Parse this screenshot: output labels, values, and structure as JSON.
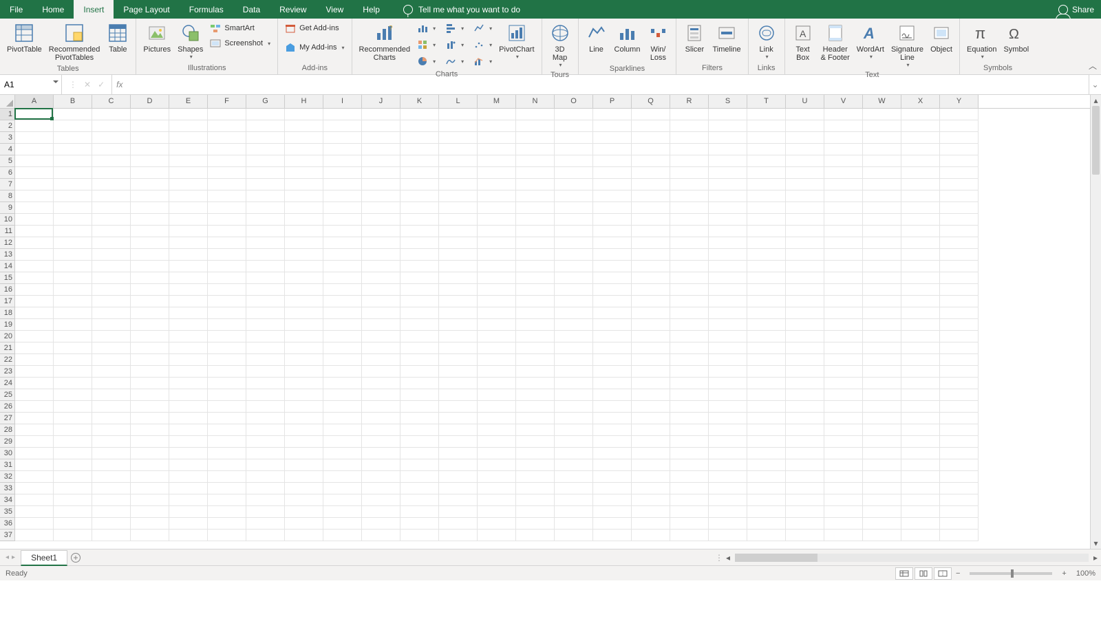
{
  "menu": {
    "tabs": [
      "File",
      "Home",
      "Insert",
      "Page Layout",
      "Formulas",
      "Data",
      "Review",
      "View",
      "Help"
    ],
    "active_index": 2,
    "tell_me": "Tell me what you want to do",
    "share": "Share"
  },
  "ribbon": {
    "groups": {
      "tables": {
        "label": "Tables",
        "items": {
          "pivot": "PivotTable",
          "rec": "Recommended\nPivotTables",
          "table": "Table"
        }
      },
      "illustrations": {
        "label": "Illustrations",
        "items": {
          "pictures": "Pictures",
          "shapes": "Shapes",
          "smartart": "SmartArt",
          "screenshot": "Screenshot"
        }
      },
      "addins": {
        "label": "Add-ins",
        "items": {
          "get": "Get Add-ins",
          "my": "My Add-ins"
        }
      },
      "charts": {
        "label": "Charts",
        "items": {
          "rec": "Recommended\nCharts",
          "pivotchart": "PivotChart"
        }
      },
      "tours": {
        "label": "Tours",
        "items": {
          "map": "3D\nMap"
        }
      },
      "sparklines": {
        "label": "Sparklines",
        "items": {
          "line": "Line",
          "column": "Column",
          "winloss": "Win/\nLoss"
        }
      },
      "filters": {
        "label": "Filters",
        "items": {
          "slicer": "Slicer",
          "timeline": "Timeline"
        }
      },
      "links": {
        "label": "Links",
        "items": {
          "link": "Link"
        }
      },
      "text": {
        "label": "Text",
        "items": {
          "textbox": "Text\nBox",
          "header": "Header\n& Footer",
          "wordart": "WordArt",
          "sig": "Signature\nLine",
          "object": "Object"
        }
      },
      "symbols": {
        "label": "Symbols",
        "items": {
          "eq": "Equation",
          "sym": "Symbol"
        }
      }
    }
  },
  "namebox": {
    "value": "A1"
  },
  "formula_bar": {
    "fx": "fx",
    "value": ""
  },
  "grid": {
    "columns": [
      "A",
      "B",
      "C",
      "D",
      "E",
      "F",
      "G",
      "H",
      "I",
      "J",
      "K",
      "L",
      "M",
      "N",
      "O",
      "P",
      "Q",
      "R",
      "S",
      "T",
      "U",
      "V",
      "W",
      "X",
      "Y"
    ],
    "rows": 37,
    "selected_cell": "A1",
    "selected_col_index": 0,
    "selected_row_index": 0
  },
  "sheets": {
    "active": "Sheet1"
  },
  "status": {
    "mode": "Ready",
    "zoom": "100%"
  }
}
